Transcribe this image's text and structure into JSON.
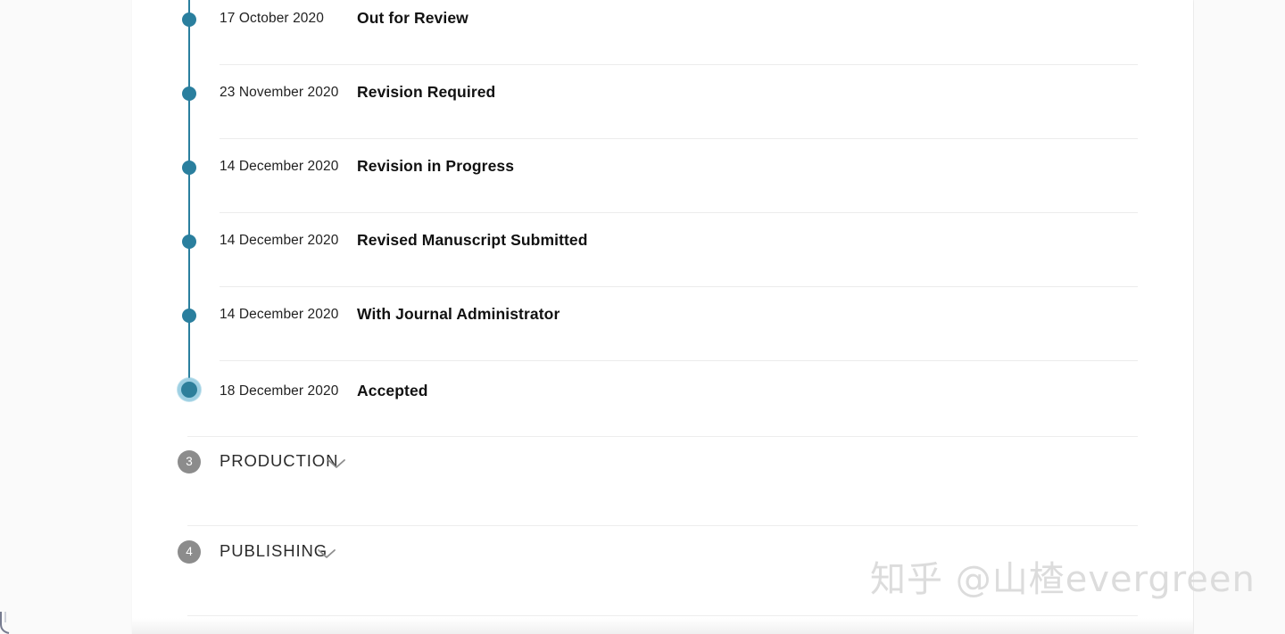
{
  "timeline": {
    "rows": [
      {
        "date": "17 October 2020",
        "status": "Out for Review",
        "active": false
      },
      {
        "date": "23 November 2020",
        "status": "Revision Required",
        "active": false
      },
      {
        "date": "14 December 2020",
        "status": "Revision in Progress",
        "active": false
      },
      {
        "date": "14 December 2020",
        "status": "Revised Manuscript Submitted",
        "active": false
      },
      {
        "date": "14 December 2020",
        "status": "With Journal Administrator",
        "active": false
      },
      {
        "date": "18 December 2020",
        "status": "Accepted",
        "active": true
      }
    ]
  },
  "sections": [
    {
      "number": "3",
      "label": "PRODUCTION"
    },
    {
      "number": "4",
      "label": "PUBLISHING"
    }
  ],
  "watermark": {
    "text": "知乎 @山楂evergreen"
  },
  "colors": {
    "timeline_accent": "#2a7f9e",
    "timeline_active_ring": "#9ed0e3",
    "badge_gray": "#8c8c8c",
    "divider": "#ececec",
    "page_background": "#ffffff",
    "gutter_background": "#fafafa"
  },
  "icons": {
    "chevron": "chevron-down-icon"
  }
}
